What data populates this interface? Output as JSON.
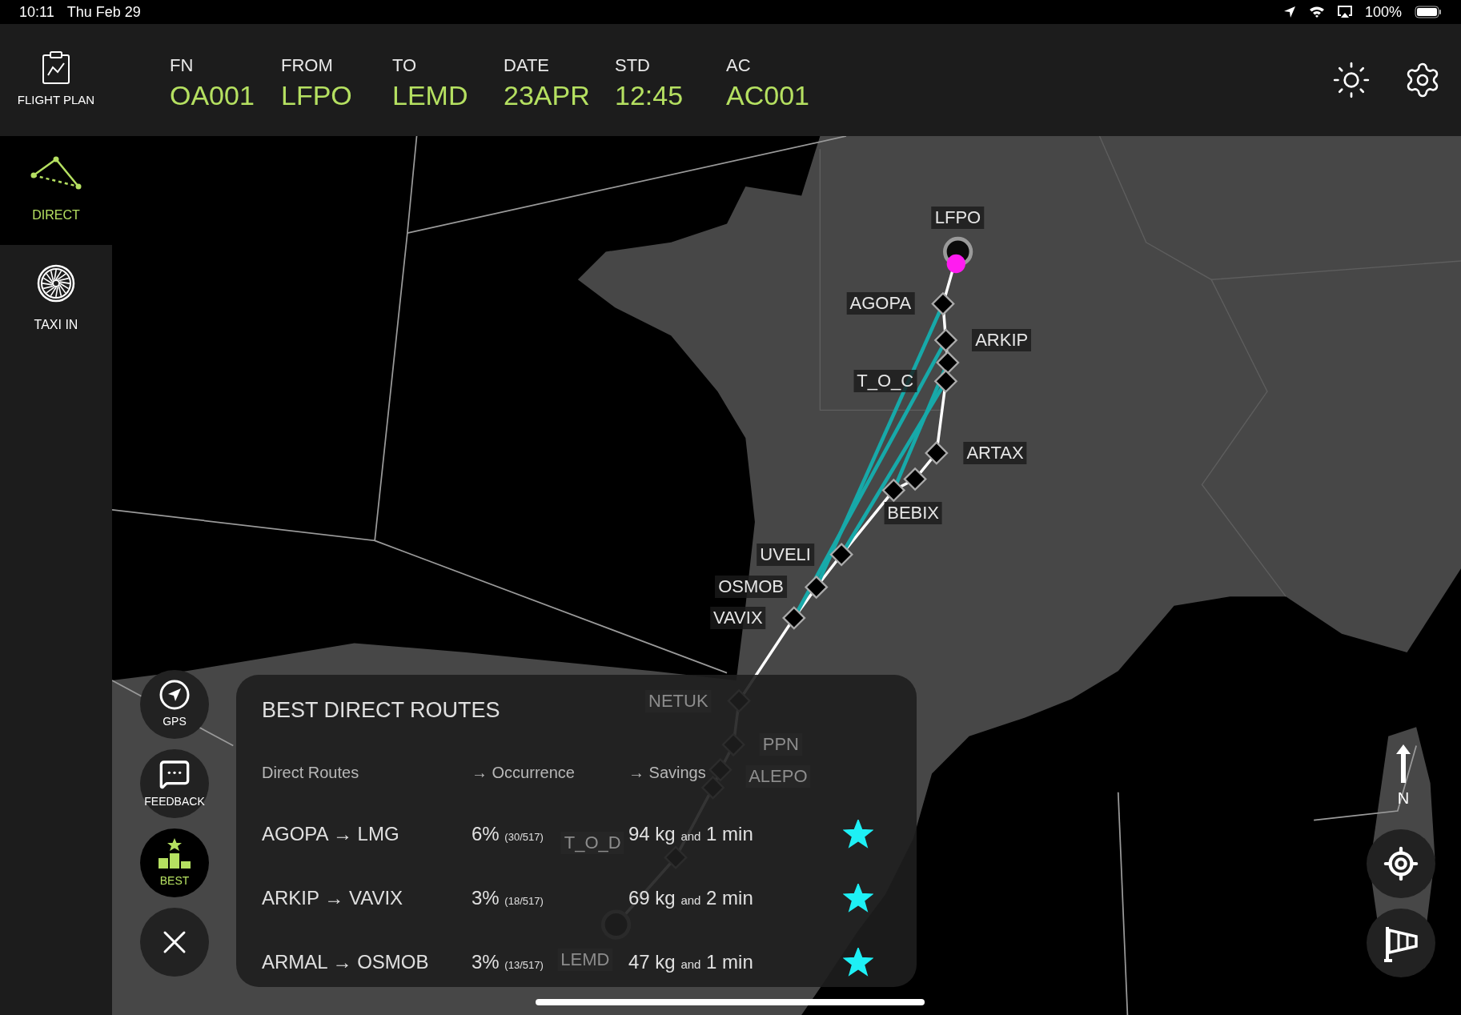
{
  "status_bar": {
    "time": "10:11",
    "date": "Thu Feb 29",
    "battery": "100%"
  },
  "header": {
    "app_button": "FLIGHT PLAN",
    "fields": [
      {
        "label": "FN",
        "value": "OA001"
      },
      {
        "label": "FROM",
        "value": "LFPO"
      },
      {
        "label": "TO",
        "value": "LEMD"
      },
      {
        "label": "DATE",
        "value": "23APR"
      },
      {
        "label": "STD",
        "value": "12:45"
      },
      {
        "label": "AC",
        "value": "AC001"
      }
    ]
  },
  "sidebar": {
    "items": [
      {
        "kind": "direct",
        "label": "DIRECT",
        "selected": true
      },
      {
        "kind": "taxi",
        "label": "TAXI IN",
        "selected": false
      }
    ]
  },
  "map": {
    "waypoints": [
      {
        "label": "LFPO",
        "kind": "airport"
      },
      {
        "label": "AGOPA",
        "kind": "fix"
      },
      {
        "label": "ARKIP",
        "kind": "fix"
      },
      {
        "kind": "fix"
      },
      {
        "label": "T_O_C",
        "kind": "fix"
      },
      {
        "label": "ARTAX",
        "kind": "fix"
      },
      {
        "kind": "fix"
      },
      {
        "label": "BEBIX",
        "kind": "fix"
      },
      {
        "label": "UVELI",
        "kind": "fix"
      },
      {
        "label": "OSMOB",
        "kind": "fix"
      },
      {
        "label": "VAVIX",
        "kind": "fix"
      },
      {
        "label": "NETUK",
        "kind": "fix"
      },
      {
        "label": "PPN",
        "kind": "fix"
      },
      {
        "kind": "fix"
      },
      {
        "label": "ALEPO",
        "kind": "fix"
      },
      {
        "label": "T_O_D",
        "kind": "fix"
      },
      {
        "label": "LEMD",
        "kind": "airport"
      }
    ],
    "compass": "N"
  },
  "tools": [
    {
      "kind": "gps",
      "label": "GPS",
      "selected": false
    },
    {
      "kind": "feedback",
      "label": "FEEDBACK",
      "selected": false
    },
    {
      "kind": "best",
      "label": "BEST",
      "selected": true
    },
    {
      "kind": "close",
      "selected": false
    }
  ],
  "panel": {
    "title": "BEST DIRECT ROUTES",
    "columns": [
      "Direct Routes",
      "→ Occurrence",
      "→ Savings"
    ],
    "rows": [
      {
        "route": "AGOPA → LMG",
        "percent": "6%",
        "ratio": "(30/517)",
        "weight": "94 kg",
        "conj": "and",
        "time": "1 min",
        "starred": true
      },
      {
        "route": "ARKIP → VAVIX",
        "percent": "3%",
        "ratio": "(18/517)",
        "weight": "69 kg",
        "conj": "and",
        "time": "2 min",
        "starred": true
      },
      {
        "route": "ARMAL → OSMOB",
        "percent": "3%",
        "ratio": "(13/517)",
        "weight": "47 kg",
        "conj": "and",
        "time": "1 min",
        "starred": true
      }
    ]
  }
}
